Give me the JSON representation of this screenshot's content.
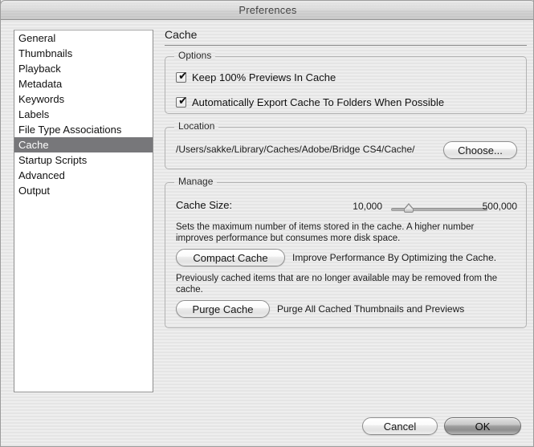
{
  "window": {
    "title": "Preferences"
  },
  "sidebar": {
    "items": [
      {
        "label": "General",
        "selected": false
      },
      {
        "label": "Thumbnails",
        "selected": false
      },
      {
        "label": "Playback",
        "selected": false
      },
      {
        "label": "Metadata",
        "selected": false
      },
      {
        "label": "Keywords",
        "selected": false
      },
      {
        "label": "Labels",
        "selected": false
      },
      {
        "label": "File Type Associations",
        "selected": false
      },
      {
        "label": "Cache",
        "selected": true
      },
      {
        "label": "Startup Scripts",
        "selected": false
      },
      {
        "label": "Advanced",
        "selected": false
      },
      {
        "label": "Output",
        "selected": false
      }
    ],
    "selected_label": "Cache"
  },
  "panel": {
    "title": "Cache",
    "options": {
      "legend": "Options",
      "checkboxes": [
        {
          "label": "Keep 100% Previews In Cache",
          "checked": true,
          "mark": "✔"
        },
        {
          "label": "Automatically Export Cache To Folders When Possible",
          "checked": true,
          "mark": "✔"
        }
      ]
    },
    "location": {
      "legend": "Location",
      "path": "/Users/sakke/Library/Caches/Adobe/Bridge CS4/Cache/",
      "choose_label": "Choose..."
    },
    "manage": {
      "legend": "Manage",
      "cache_size_label": "Cache Size:",
      "slider_min_label": "10,000",
      "slider_max_label": "500,000",
      "slider_min_value": 10000,
      "slider_max_value": 500000,
      "slider_value": 32000,
      "slider_percent": 18,
      "size_hint": "Sets the maximum number of items stored in the cache. A higher number improves performance but consumes more disk space.",
      "compact_button_label": "Compact Cache",
      "compact_description": "Improve Performance By Optimizing the Cache.",
      "compact_hint": "Previously cached items that are no longer available may be removed from the cache.",
      "purge_button_label": "Purge Cache",
      "purge_description": "Purge All Cached Thumbnails and Previews"
    }
  },
  "footer": {
    "cancel_label": "Cancel",
    "ok_label": "OK"
  },
  "colors": {
    "selection": "#77777a",
    "window_bg": "#eaeaea",
    "border": "#b2b2b2"
  }
}
